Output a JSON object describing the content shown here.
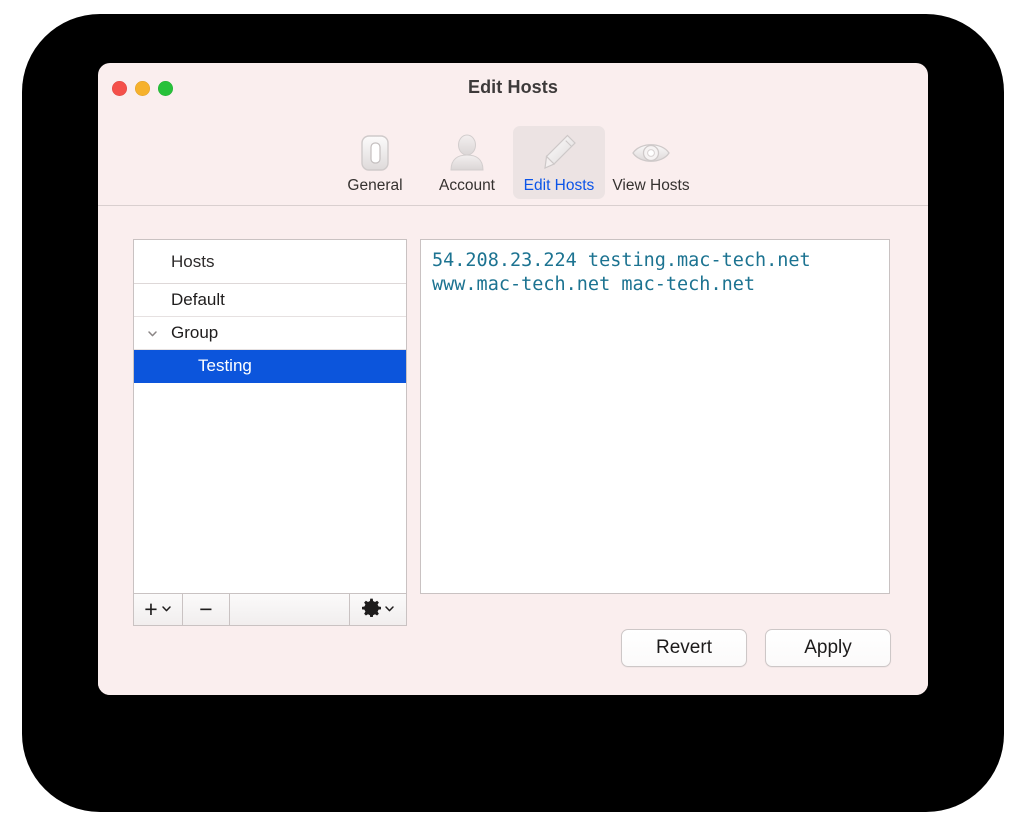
{
  "window": {
    "title": "Edit Hosts",
    "traffic_lights": [
      {
        "name": "close",
        "color": "#f4504a"
      },
      {
        "name": "minimize",
        "color": "#f6b12c"
      },
      {
        "name": "maximize",
        "color": "#27c13a"
      }
    ]
  },
  "toolbar": {
    "items": [
      {
        "label": "General",
        "icon": "device-toggle-icon",
        "selected": false
      },
      {
        "label": "Account",
        "icon": "person-icon",
        "selected": false
      },
      {
        "label": "Edit Hosts",
        "icon": "pencil-icon",
        "selected": true
      },
      {
        "label": "View Hosts",
        "icon": "eye-icon",
        "selected": false
      }
    ],
    "selected_label_color": "#0b54e8"
  },
  "sidebar": {
    "header": "Hosts",
    "rows": [
      {
        "label": "Default",
        "level": 0,
        "selected": false,
        "disclosure": null
      },
      {
        "label": "Group",
        "level": 0,
        "selected": false,
        "disclosure": "chevron-down-icon"
      },
      {
        "label": "Testing",
        "level": 1,
        "selected": true,
        "disclosure": null
      }
    ],
    "selection_color": "#0c55dc",
    "bottom_bar": {
      "add_glyph": "+",
      "add_menu_icon": "chevron-down-icon",
      "remove_glyph": "−",
      "gear_icon": "gear-icon",
      "gear_menu_icon": "chevron-down-icon"
    }
  },
  "editor": {
    "content": "54.208.23.224 testing.mac-tech.net www.mac-tech.net mac-tech.net",
    "text_color": "#1c7391"
  },
  "footer": {
    "revert_label": "Revert",
    "apply_label": "Apply"
  }
}
